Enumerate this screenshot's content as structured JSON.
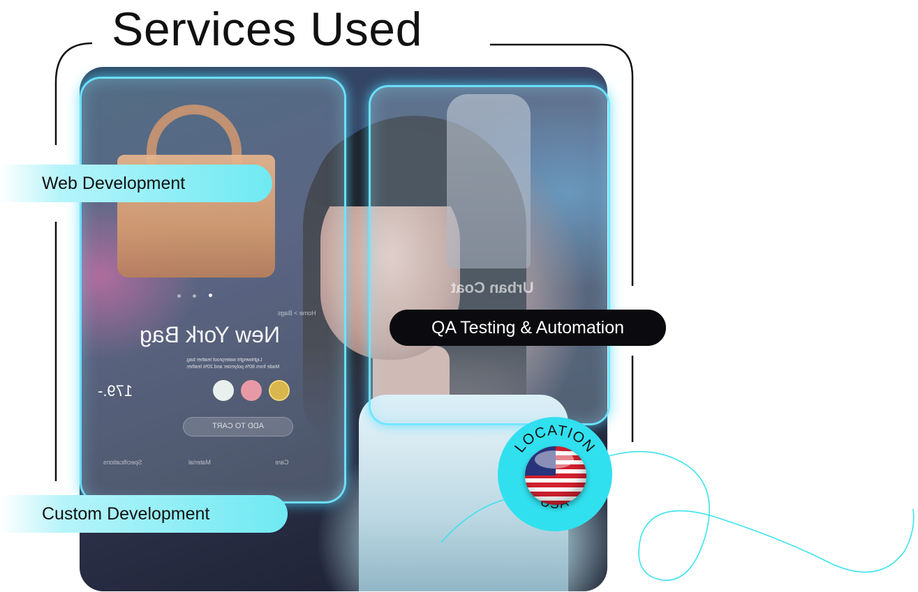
{
  "header": {
    "title": "Services Used"
  },
  "services": {
    "web": "Web Development",
    "qa": "QA Testing & Automation",
    "custom": "Custom Development"
  },
  "mockup": {
    "breadcrumb": "Home > Bags",
    "product_name": "New York Bag",
    "description_line1": "Lightweight waterproof leather bag.",
    "description_line2": "Made from 80% polyester and 20% leather.",
    "price": "179.-",
    "add_to_cart": "ADD TO CART",
    "tabs": [
      "Care",
      "Material",
      "Specifications"
    ],
    "coat_label": "Urban Coat",
    "swatch_colors": [
      "#e9f0ee",
      "#e79aa6",
      "#d9b64e"
    ]
  },
  "location_badge": {
    "top_text": "LOCATION",
    "bottom_text": "USA",
    "accent_color": "#31e0ef",
    "icon": "us-flag-icon"
  },
  "colors": {
    "pill_cyan": "#6fe9f2",
    "pill_dark": "#0b0b0f",
    "text_dark": "#111111"
  }
}
